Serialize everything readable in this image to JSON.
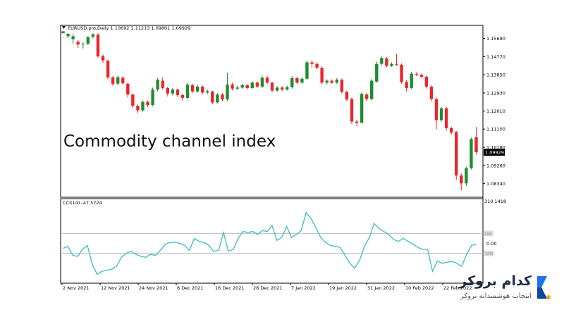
{
  "colors": {
    "bull": "#1e8c2e",
    "bear": "#e8262c",
    "cci_line": "#3bbcc0",
    "level_line": "#bdbdbd",
    "axis": "#000000",
    "brand_accent": "#1a73e8",
    "brand_dot": "#f5a623"
  },
  "brand": {
    "name": "کدام بروکر",
    "tagline": "انتخاب هوشمندانه بروکر",
    "logo_icon": "chevron-logo-icon"
  },
  "chart_data": [
    {
      "type": "candlestick",
      "title": "Commodity channel index",
      "header": "EURUSD.pro,Daily  1.10692 1.11213 1.09801 1.09929",
      "ylim": [
        1.0765,
        1.1635
      ],
      "yticks": [
        "1.15690",
        "1.14770",
        "1.13850",
        "1.12930",
        "1.12010",
        "1.11100",
        "1.10180",
        "1.09260",
        "1.08340"
      ],
      "last_price": "1.09929",
      "grid": false,
      "candles": [
        [
          1.1595,
          1.1605,
          1.1575,
          1.1572
        ],
        [
          1.158,
          1.1592,
          1.1596,
          1.157
        ],
        [
          1.1565,
          1.158,
          1.1592,
          1.1542
        ],
        [
          1.1552,
          1.1538,
          1.156,
          1.152
        ],
        [
          1.154,
          1.1542,
          1.155,
          1.1518
        ],
        [
          1.1542,
          1.1575,
          1.1582,
          1.1535
        ],
        [
          1.1578,
          1.159,
          1.1595,
          1.1568
        ],
        [
          1.1588,
          1.1478,
          1.1595,
          1.147
        ],
        [
          1.148,
          1.1458,
          1.1488,
          1.1445
        ],
        [
          1.1456,
          1.1372,
          1.1462,
          1.1362
        ],
        [
          1.1372,
          1.1338,
          1.138,
          1.1328
        ],
        [
          1.134,
          1.1372,
          1.138,
          1.133
        ],
        [
          1.137,
          1.1342,
          1.1378,
          1.1335
        ],
        [
          1.134,
          1.1285,
          1.1345,
          1.127
        ],
        [
          1.1285,
          1.1228,
          1.129,
          1.1215
        ],
        [
          1.1228,
          1.1205,
          1.1235,
          1.1192
        ],
        [
          1.1205,
          1.1248,
          1.1255,
          1.1198
        ],
        [
          1.1248,
          1.1232,
          1.1255,
          1.1222
        ],
        [
          1.1232,
          1.131,
          1.132,
          1.1225
        ],
        [
          1.131,
          1.136,
          1.137,
          1.13
        ],
        [
          1.1355,
          1.1318,
          1.1372,
          1.131
        ],
        [
          1.1318,
          1.129,
          1.1325,
          1.1275
        ],
        [
          1.129,
          1.131,
          1.1318,
          1.128
        ],
        [
          1.131,
          1.1282,
          1.1315,
          1.1272
        ],
        [
          1.1282,
          1.1268,
          1.129,
          1.1255
        ],
        [
          1.1268,
          1.1335,
          1.1345,
          1.126
        ],
        [
          1.1332,
          1.13,
          1.134,
          1.1292
        ],
        [
          1.13,
          1.1325,
          1.1335,
          1.1295
        ],
        [
          1.1325,
          1.1295,
          1.1332,
          1.1285
        ],
        [
          1.1295,
          1.1302,
          1.131,
          1.1288
        ],
        [
          1.13,
          1.1245,
          1.1305,
          1.1235
        ],
        [
          1.1245,
          1.1285,
          1.1292,
          1.124
        ],
        [
          1.1285,
          1.126,
          1.1292,
          1.125
        ],
        [
          1.126,
          1.1335,
          1.1395,
          1.1252
        ],
        [
          1.1335,
          1.1315,
          1.1345,
          1.1305
        ],
        [
          1.1315,
          1.132,
          1.133,
          1.1308
        ],
        [
          1.132,
          1.1332,
          1.134,
          1.1315
        ],
        [
          1.1332,
          1.1318,
          1.1338,
          1.131
        ],
        [
          1.1318,
          1.1345,
          1.1352,
          1.1312
        ],
        [
          1.1345,
          1.1325,
          1.1352,
          1.1318
        ],
        [
          1.1325,
          1.137,
          1.138,
          1.1318
        ],
        [
          1.137,
          1.1345,
          1.1378,
          1.1335
        ],
        [
          1.1345,
          1.1305,
          1.135,
          1.1295
        ],
        [
          1.1305,
          1.132,
          1.1328,
          1.1298
        ],
        [
          1.132,
          1.131,
          1.1328,
          1.1302
        ],
        [
          1.131,
          1.1322,
          1.133,
          1.1305
        ],
        [
          1.1322,
          1.1368,
          1.1378,
          1.1315
        ],
        [
          1.1368,
          1.1345,
          1.1375,
          1.1338
        ],
        [
          1.1345,
          1.1365,
          1.1372,
          1.1338
        ],
        [
          1.1365,
          1.1448,
          1.146,
          1.1358
        ],
        [
          1.1448,
          1.144,
          1.1458,
          1.142
        ],
        [
          1.144,
          1.142,
          1.1448,
          1.1412
        ],
        [
          1.142,
          1.1345,
          1.1428,
          1.1335
        ],
        [
          1.1345,
          1.1355,
          1.1362,
          1.1335
        ],
        [
          1.1355,
          1.1345,
          1.1362,
          1.1338
        ],
        [
          1.1345,
          1.136,
          1.1368,
          1.1338
        ],
        [
          1.136,
          1.1298,
          1.1365,
          1.129
        ],
        [
          1.1298,
          1.126,
          1.1305,
          1.125
        ],
        [
          1.1262,
          1.1148,
          1.127,
          1.1135
        ],
        [
          1.1148,
          1.1142,
          1.1158,
          1.1125
        ],
        [
          1.1142,
          1.1288,
          1.1295,
          1.1138
        ],
        [
          1.1285,
          1.1262,
          1.1292,
          1.125
        ],
        [
          1.1262,
          1.1355,
          1.1365,
          1.1255
        ],
        [
          1.135,
          1.144,
          1.1452,
          1.1345
        ],
        [
          1.144,
          1.147,
          1.1478,
          1.1432
        ],
        [
          1.1468,
          1.143,
          1.1475,
          1.1422
        ],
        [
          1.143,
          1.144,
          1.1448,
          1.1425
        ],
        [
          1.144,
          1.1436,
          1.149,
          1.143
        ],
        [
          1.1436,
          1.1348,
          1.1442,
          1.134
        ],
        [
          1.1348,
          1.1318,
          1.136,
          1.13
        ],
        [
          1.1318,
          1.139,
          1.14,
          1.1312
        ],
        [
          1.139,
          1.1385,
          1.1398,
          1.1378
        ],
        [
          1.1385,
          1.1375,
          1.1392,
          1.1368
        ],
        [
          1.1375,
          1.1325,
          1.1382,
          1.1315
        ],
        [
          1.1325,
          1.1262,
          1.1332,
          1.125
        ],
        [
          1.1262,
          1.1155,
          1.127,
          1.111
        ],
        [
          1.1155,
          1.1215,
          1.1222,
          1.1148
        ],
        [
          1.1215,
          1.1115,
          1.1222,
          1.1102
        ],
        [
          1.1115,
          1.1092,
          1.1122,
          1.1082
        ],
        [
          1.1095,
          1.0875,
          1.11,
          1.0852
        ],
        [
          1.0875,
          1.0835,
          1.0885,
          1.08
        ],
        [
          1.0835,
          1.0912,
          1.092,
          1.0822
        ],
        [
          1.0912,
          1.106,
          1.1068,
          1.0905
        ],
        [
          1.1069,
          1.0993,
          1.1121,
          1.098
        ]
      ],
      "xticks": [
        "2 Nov 2021",
        "12 Nov 2021",
        "24 Nov 2021",
        "6 Dec 2021",
        "16 Dec 2021",
        "28 Dec 2021",
        "7 Jan 2022",
        "19 Jan 2022",
        "31 Jan 2022",
        "10 Feb 2022",
        "22 Feb 2022"
      ]
    },
    {
      "type": "line",
      "header": "CCI(14) -47.5724",
      "series": [
        {
          "name": "CCI(14)",
          "values": [
            -50,
            -30,
            -120,
            -130,
            -60,
            -20,
            -210,
            -310,
            -280,
            -270,
            -260,
            -230,
            -140,
            -100,
            -80,
            -110,
            -130,
            -140,
            -110,
            -120,
            -70,
            -10,
            10,
            10,
            0,
            -20,
            -70,
            50,
            20,
            10,
            -20,
            -80,
            -70,
            110,
            -80,
            -60,
            50,
            120,
            110,
            120,
            90,
            130,
            120,
            180,
            30,
            60,
            170,
            60,
            90,
            130,
            310,
            250,
            160,
            60,
            10,
            -20,
            -30,
            -40,
            -120,
            -200,
            -250,
            -170,
            -30,
            60,
            200,
            150,
            120,
            90,
            40,
            20,
            50,
            20,
            -10,
            -40,
            -60,
            -60,
            -280,
            -180,
            -200,
            -190,
            -180,
            -200,
            -230,
            -110,
            -20,
            -10
          ]
        }
      ],
      "ylim": [
        -400,
        450
      ],
      "levels": [
        100,
        -100
      ],
      "yticks": [
        "310.1418",
        "0.00"
      ],
      "right_labels": [
        "100",
        "-100"
      ]
    }
  ]
}
